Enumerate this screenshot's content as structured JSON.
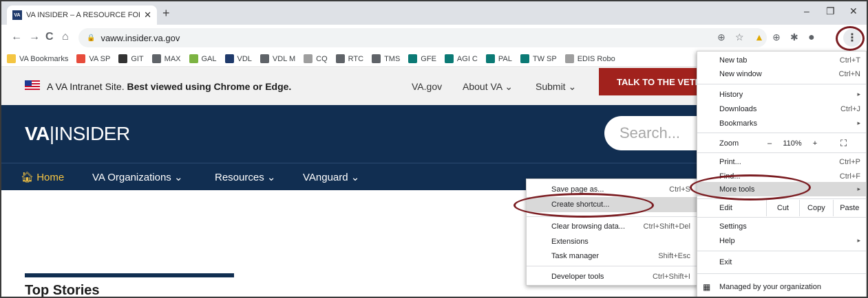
{
  "browser": {
    "tab": {
      "favicon": "VA",
      "title": "VA INSIDER – A RESOURCE FOR V",
      "close": "✕"
    },
    "new_tab": "+",
    "window": {
      "minimize": "–",
      "restore": "❐",
      "close": "✕"
    },
    "nav": {
      "back": "←",
      "forward": "→",
      "reload": "C",
      "home": "⌂"
    },
    "url": "vaww.insider.va.gov",
    "toolbar_icons": {
      "zoom": "⊕",
      "star": "☆",
      "ext1": "▲",
      "ext2": "⊕",
      "extensions": "✱",
      "profile": "●",
      "menu": "⋮"
    },
    "bookmarks": [
      {
        "label": "VA Bookmarks",
        "color": "#f4c542"
      },
      {
        "label": "VA SP",
        "color": "#e74c3c"
      },
      {
        "label": "GIT",
        "color": "#333333"
      },
      {
        "label": "MAX",
        "color": "#5f6368"
      },
      {
        "label": "GAL",
        "color": "#7cb342"
      },
      {
        "label": "VDL",
        "color": "#1f3a6b"
      },
      {
        "label": "VDL M",
        "color": "#5f6368"
      },
      {
        "label": "CQ",
        "color": "#9e9e9e"
      },
      {
        "label": "RTC",
        "color": "#5f6368"
      },
      {
        "label": "TMS",
        "color": "#5f6368"
      },
      {
        "label": "GFE",
        "color": "#0b7a75"
      },
      {
        "label": "AGI C",
        "color": "#0b7a75"
      },
      {
        "label": "PAL",
        "color": "#0b7a75"
      },
      {
        "label": "TW SP",
        "color": "#0b7a75"
      },
      {
        "label": "EDIS Robo",
        "color": "#9e9e9e"
      }
    ]
  },
  "page": {
    "banner": {
      "prefix": "A VA Intranet Site. ",
      "strong": "Best viewed using Chrome or Edge."
    },
    "top_links": {
      "vagov": "VA.gov",
      "about": "About VA ⌄",
      "submit": "Submit ⌄"
    },
    "talk_button": "TALK TO THE VETERAN",
    "logo": {
      "va": "VA",
      "sep": "|",
      "insider": "INSIDER"
    },
    "search_placeholder": "Search...",
    "nav": {
      "home": "Home",
      "orgs": "VA Organizations ⌄",
      "resources": "Resources ⌄",
      "vanguard": "VAnguard ⌄"
    },
    "top_stories": "Top Stories"
  },
  "more_tools_menu": [
    {
      "label": "Save page as...",
      "shortcut": "Ctrl+S"
    },
    {
      "label": "Create shortcut...",
      "shortcut": ""
    },
    {
      "label": "Clear browsing data...",
      "shortcut": "Ctrl+Shift+Del"
    },
    {
      "label": "Extensions",
      "shortcut": ""
    },
    {
      "label": "Task manager",
      "shortcut": "Shift+Esc"
    },
    {
      "label": "Developer tools",
      "shortcut": "Ctrl+Shift+I"
    }
  ],
  "chrome_menu": {
    "new_tab": {
      "label": "New tab",
      "shortcut": "Ctrl+T"
    },
    "new_window": {
      "label": "New window",
      "shortcut": "Ctrl+N"
    },
    "history": "History",
    "downloads": {
      "label": "Downloads",
      "shortcut": "Ctrl+J"
    },
    "bookmarks": "Bookmarks",
    "zoom": {
      "label": "Zoom",
      "minus": "–",
      "level": "110%",
      "plus": "+",
      "fullscreen": "⛶"
    },
    "print": {
      "label": "Print...",
      "shortcut": "Ctrl+P"
    },
    "find": {
      "label": "Find...",
      "shortcut": "Ctrl+F"
    },
    "more_tools": "More tools",
    "edit": {
      "label": "Edit",
      "cut": "Cut",
      "copy": "Copy",
      "paste": "Paste"
    },
    "settings": "Settings",
    "help": "Help",
    "exit": "Exit",
    "managed": "Managed by your organization",
    "arrow": "▸"
  }
}
